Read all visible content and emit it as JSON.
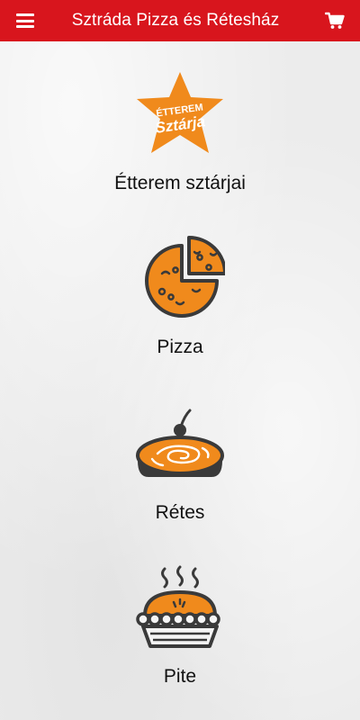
{
  "header": {
    "title": "Sztráda Pizza és Rétesház",
    "menu_icon": "hamburger-menu-icon",
    "cart_icon": "shopping-cart-icon",
    "background_color": "#d8151d"
  },
  "categories": [
    {
      "label": "Étterem sztárjai",
      "icon": "star-badge-icon",
      "badge_text_line1": "ÉTTEREM",
      "badge_text_line2": "Sztárja"
    },
    {
      "label": "Pizza",
      "icon": "pizza-icon"
    },
    {
      "label": "Rétes",
      "icon": "strudel-icon"
    },
    {
      "label": "Pite",
      "icon": "pie-icon"
    }
  ],
  "colors": {
    "accent": "#f08a1c",
    "outline": "#3a3a3a"
  }
}
